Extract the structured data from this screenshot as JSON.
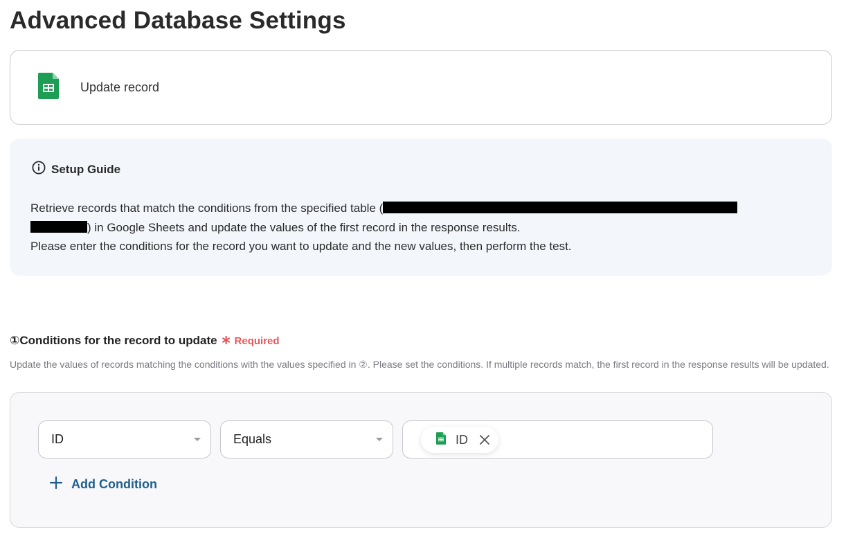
{
  "page": {
    "title": "Advanced Database Settings"
  },
  "action": {
    "icon": "google-sheets-icon",
    "label": "Update record"
  },
  "guide": {
    "icon": "info-icon",
    "title": "Setup Guide",
    "line1_prefix": "Retrieve records that match the conditions from the specified table (",
    "line2_suffix": ") in Google Sheets and update the values of the first record in the response results.",
    "line3": "Please enter the conditions for the record you want to update and the new values, then perform the test."
  },
  "conditions_section": {
    "title": "①Conditions for the record to update",
    "required_mark": "∗",
    "required_label": "Required",
    "description": "Update the values of records matching the conditions with the values specified in ②. Please set the conditions. If multiple records match, the first record in the response results will be updated."
  },
  "condition_row": {
    "field_value": "ID",
    "operator_value": "Equals",
    "value_chip": {
      "icon": "google-sheets-icon",
      "label": "ID"
    }
  },
  "add_condition": {
    "icon": "plus-icon",
    "label": "Add Condition"
  },
  "colors": {
    "accent_link": "#1f5f8b",
    "required": "#e8585a",
    "sheets_green": "#1e9e54",
    "guide_bg": "#f3f7fb"
  }
}
